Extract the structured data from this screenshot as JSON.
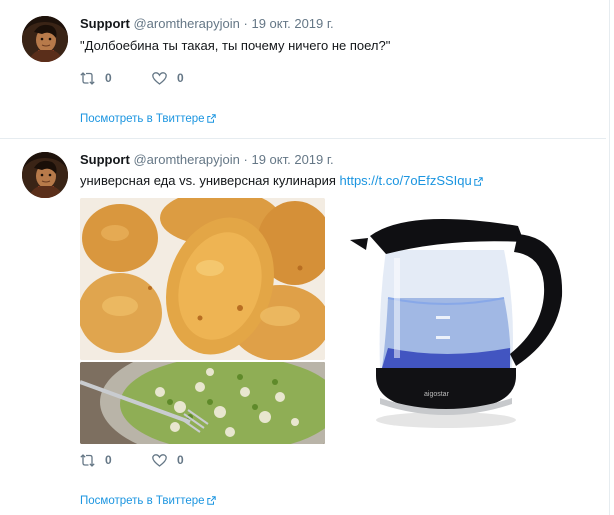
{
  "tweets": [
    {
      "author": "Support",
      "handle": "@aromtherapyjoin",
      "separator": "·",
      "date": "19 окт. 2019 г.",
      "text": "\"Долбоебина ты такая, ты почему ничего не поел?\"",
      "retweets": "0",
      "likes": "0",
      "view_link": "Посмотреть в Твиттере"
    },
    {
      "author": "Support",
      "handle": "@aromtherapyjoin",
      "separator": "·",
      "date": "19 окт. 2019 г.",
      "text": "универсная еда vs. универсная кулинария",
      "link": "https://t.co/7oEfzSSIqu",
      "retweets": "0",
      "likes": "0",
      "view_link": "Посмотреть в Твиттере"
    }
  ],
  "colors": {
    "link": "#1b95e0",
    "muted": "#657786",
    "text": "#14171a",
    "divider": "#e6ecf0"
  },
  "icons": [
    "avatar",
    "retweet-icon",
    "heart-icon",
    "external-link-icon"
  ]
}
